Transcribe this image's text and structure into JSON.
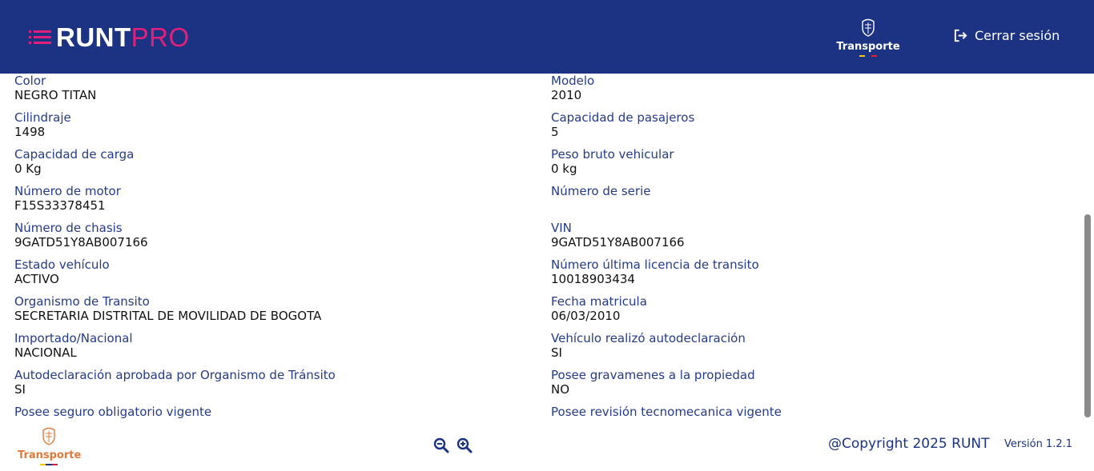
{
  "header": {
    "logo": {
      "primary": "RUNT",
      "secondary": "PRO"
    },
    "ministry_label": "Transporte",
    "logout_label": "Cerrar sesión",
    "colors": {
      "background": "#1b3382",
      "brand_accent": "#e0207a"
    }
  },
  "fields": [
    {
      "label": "Color",
      "value": "NEGRO TITAN"
    },
    {
      "label": "Modelo",
      "value": "2010"
    },
    {
      "label": "Cilindraje",
      "value": "1498"
    },
    {
      "label": "Capacidad de pasajeros",
      "value": "5"
    },
    {
      "label": "Capacidad de carga",
      "value": "0 Kg"
    },
    {
      "label": "Peso bruto vehicular",
      "value": "0 kg"
    },
    {
      "label": "Número de motor",
      "value": "F15S33378451"
    },
    {
      "label": "Número de serie",
      "value": ""
    },
    {
      "label": "Número de chasis",
      "value": "9GATD51Y8AB007166"
    },
    {
      "label": "VIN",
      "value": "9GATD51Y8AB007166"
    },
    {
      "label": "Estado vehículo",
      "value": "ACTIVO"
    },
    {
      "label": "Número última licencia de transito",
      "value": "10018903434"
    },
    {
      "label": "Organismo de Transito",
      "value": "SECRETARIA DISTRITAL DE MOVILIDAD DE BOGOTA"
    },
    {
      "label": "Fecha matricula",
      "value": "06/03/2010"
    },
    {
      "label": "Importado/Nacional",
      "value": "NACIONAL"
    },
    {
      "label": "Vehículo realizó autodeclaración",
      "value": "SI"
    },
    {
      "label": "Autodeclaración aprobada por Organismo de Tránsito",
      "value": "SI"
    },
    {
      "label": "Posee gravamenes a la propiedad",
      "value": "NO"
    },
    {
      "label": "Posee seguro obligatorio vigente",
      "value": ""
    },
    {
      "label": "Posee revisión tecnomecanica vigente",
      "value": ""
    }
  ],
  "footer": {
    "ministry_label": "Transporte",
    "zoom_out_icon": "zoom-out-icon",
    "zoom_in_icon": "zoom-in-icon",
    "copyright": "@Copyright 2025 RUNT",
    "version": "Versión 1.2.1"
  }
}
